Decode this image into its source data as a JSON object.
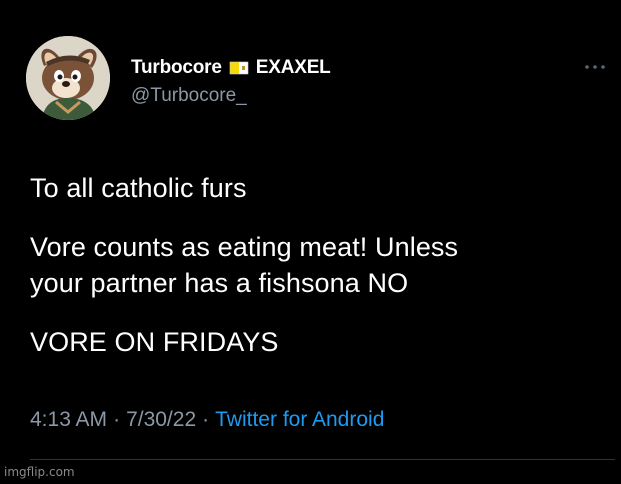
{
  "tweet": {
    "author": {
      "display_name": "Turbocore",
      "display_name_suffix": "EXAXEL",
      "flag_icon": "vatican-flag-icon",
      "handle": "@Turbocore_"
    },
    "more_icon": "ellipsis-icon",
    "body": {
      "line1": "To all catholic furs",
      "line2": "Vore counts as eating meat! Unless",
      "line3": "your partner has a fishsona NO",
      "line4": "VORE ON FRIDAYS"
    },
    "meta": {
      "time": "4:13 AM",
      "separator": "·",
      "date": "7/30/22",
      "source": "Twitter for Android"
    }
  },
  "watermark": "imgflip.com",
  "colors": {
    "background": "#000000",
    "text": "#ffffff",
    "secondary": "#8b98a5",
    "link": "#1d9bf0",
    "divider": "#2f3336"
  }
}
